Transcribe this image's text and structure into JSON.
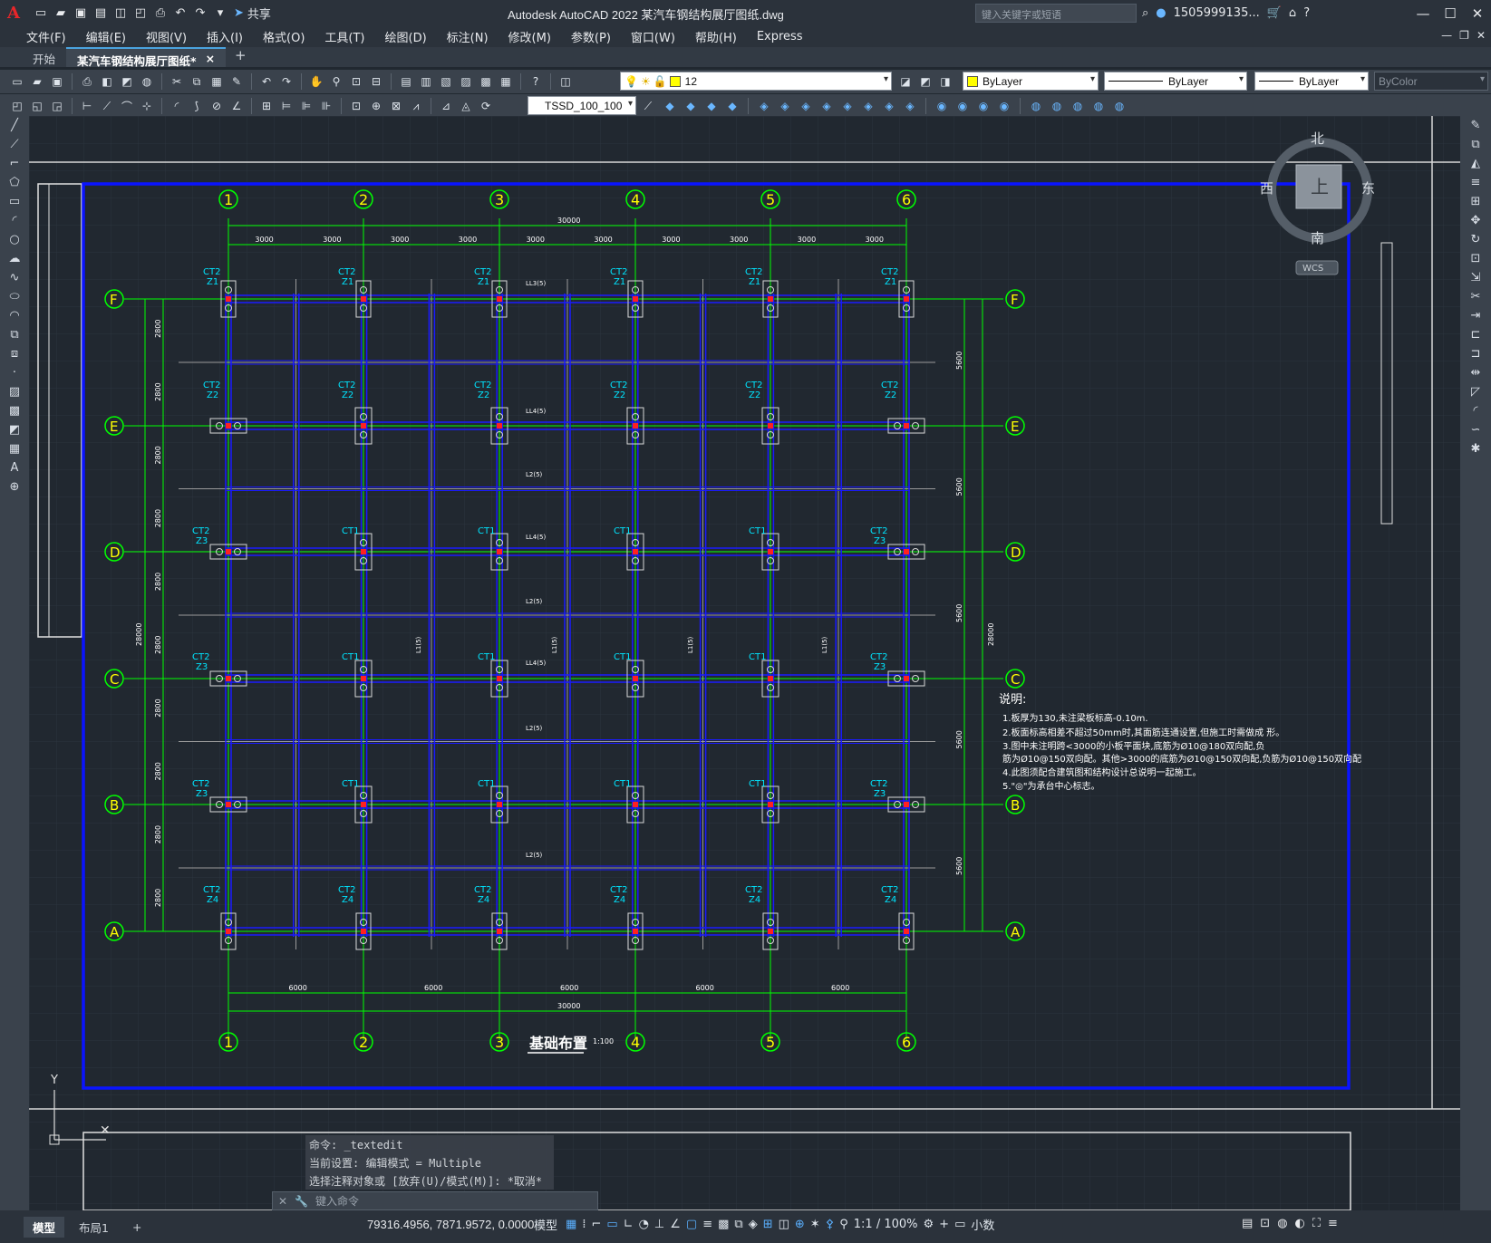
{
  "app": {
    "title": "Autodesk AutoCAD 2022    某汽车钢结构展厅图纸.dwg",
    "logo": "A",
    "share_label": "共享",
    "search_placeholder": "键入关键字或短语",
    "user": "1505999135...",
    "help": "?"
  },
  "menu": [
    "文件(F)",
    "编辑(E)",
    "视图(V)",
    "插入(I)",
    "格式(O)",
    "工具(T)",
    "绘图(D)",
    "标注(N)",
    "修改(M)",
    "参数(P)",
    "窗口(W)",
    "帮助(H)",
    "Express"
  ],
  "tabs": {
    "start": "开始",
    "active": "某汽车钢结构展厅图纸*",
    "close": "×",
    "plus": "+"
  },
  "toolbar": {
    "layer_value": "12",
    "color_value": "ByLayer",
    "linetype_value": "ByLayer",
    "lineweight_value": "ByLayer",
    "plotstyle_value": "ByColor",
    "dimstyle_value": "TSSD_100_100"
  },
  "viewcube": {
    "north": "北",
    "south": "南",
    "east": "东",
    "west": "西",
    "top": "上",
    "wcs": "WCS"
  },
  "drawing": {
    "axes_num": [
      "1",
      "2",
      "3",
      "4",
      "5",
      "6"
    ],
    "axes_letter": [
      "F",
      "E",
      "D",
      "C",
      "B",
      "A"
    ],
    "top_total": "30000",
    "top_spans": [
      "3000",
      "3000",
      "3000",
      "3000",
      "3000",
      "3000",
      "3000",
      "3000",
      "3000",
      "3000"
    ],
    "bottom_spans": [
      "6000",
      "6000",
      "6000",
      "6000",
      "6000"
    ],
    "bottom_total": "30000",
    "left_spans": [
      "2800",
      "2800",
      "2800",
      "2800",
      "2800",
      "2800",
      "2800",
      "2800",
      "2800",
      "2800"
    ],
    "left_total": "28000",
    "right_spans": [
      "5600",
      "5600",
      "5600",
      "5600",
      "5600"
    ],
    "right_total": "28000",
    "title": "基础布置",
    "title_scale": "1:100",
    "row_f_labels": [
      "CT2\nZ1",
      "CT2\nZ1",
      "CT2\nZ1",
      "CT2\nZ1",
      "CT2\nZ1",
      "CT2\nZ1"
    ],
    "ct_labels": [
      "CT2",
      "Z2",
      "CT1",
      "Z3",
      "Z4"
    ],
    "notes_title": "说明:",
    "notes": [
      "1.板厚为130,未注梁板标高-0.10m.",
      "2.板面标高相差不超过50mm时,其面筋连通设置,但施工时需做成      形。",
      "3.图中未注明跨<3000的小板平面块,底筋为Ø10@180双向配,负",
      "  筋为Ø10@150双向配。其他>3000的底筋为Ø10@150双向配,负筋为Ø10@150双向配",
      "4.此图须配合建筑图和结构设计总说明一起施工。",
      "5.\"◎\"为承台中心标志。"
    ],
    "ucs_y": "Y",
    "beam_labels": [
      "LL3(5)",
      "LL4(5)",
      "L2(5)",
      "L1(5)"
    ]
  },
  "command": {
    "history": [
      "命令: _textedit",
      "当前设置: 编辑模式 = Multiple",
      "选择注释对象或 [放弃(U)/模式(M)]: *取消*"
    ],
    "prompt": "键入命令"
  },
  "status": {
    "layouts": [
      "模型",
      "布局1"
    ],
    "plus": "+",
    "coords": "79316.4956, 7871.9572, 0.0000",
    "model": "模型",
    "scale": "1:1 / 100%",
    "units": "小数"
  },
  "colors": {
    "grid_green": "#00ff00",
    "beam_blue": "#1a1aff",
    "frame_blue": "#0000ff",
    "label_cyan": "#00e5ff",
    "axis_yellow": "#ffff00",
    "dim_white": "#ffffff"
  }
}
